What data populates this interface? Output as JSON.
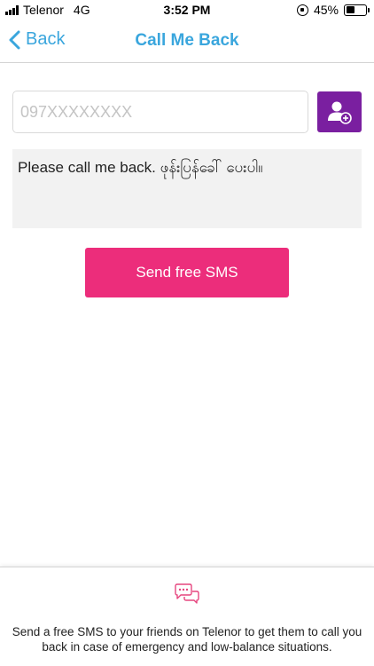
{
  "status_bar": {
    "carrier": "Telenor",
    "network": "4G",
    "time": "3:52 PM",
    "battery": "45%",
    "battery_level": 0.45
  },
  "nav": {
    "back_label": "Back",
    "title": "Call Me Back"
  },
  "form": {
    "phone_placeholder": "097XXXXXXXX",
    "phone_value": "",
    "message": "Please call me back. ဖုန်းပြန်ခေါ် ပေးပါ။",
    "send_label": "Send free SMS"
  },
  "info": {
    "description": "Send a free SMS to your friends on Telenor to get them to call you back in case of emergency and low-balance situations."
  },
  "colors": {
    "accent_blue": "#3aa6dd",
    "contact_purple": "#7a1fa0",
    "send_pink": "#ec2d7b",
    "icon_pink": "#e6467f"
  },
  "icons": {
    "back": "chevron-left-icon",
    "contact": "add-contact-icon",
    "info": "chat-bubbles-icon"
  }
}
